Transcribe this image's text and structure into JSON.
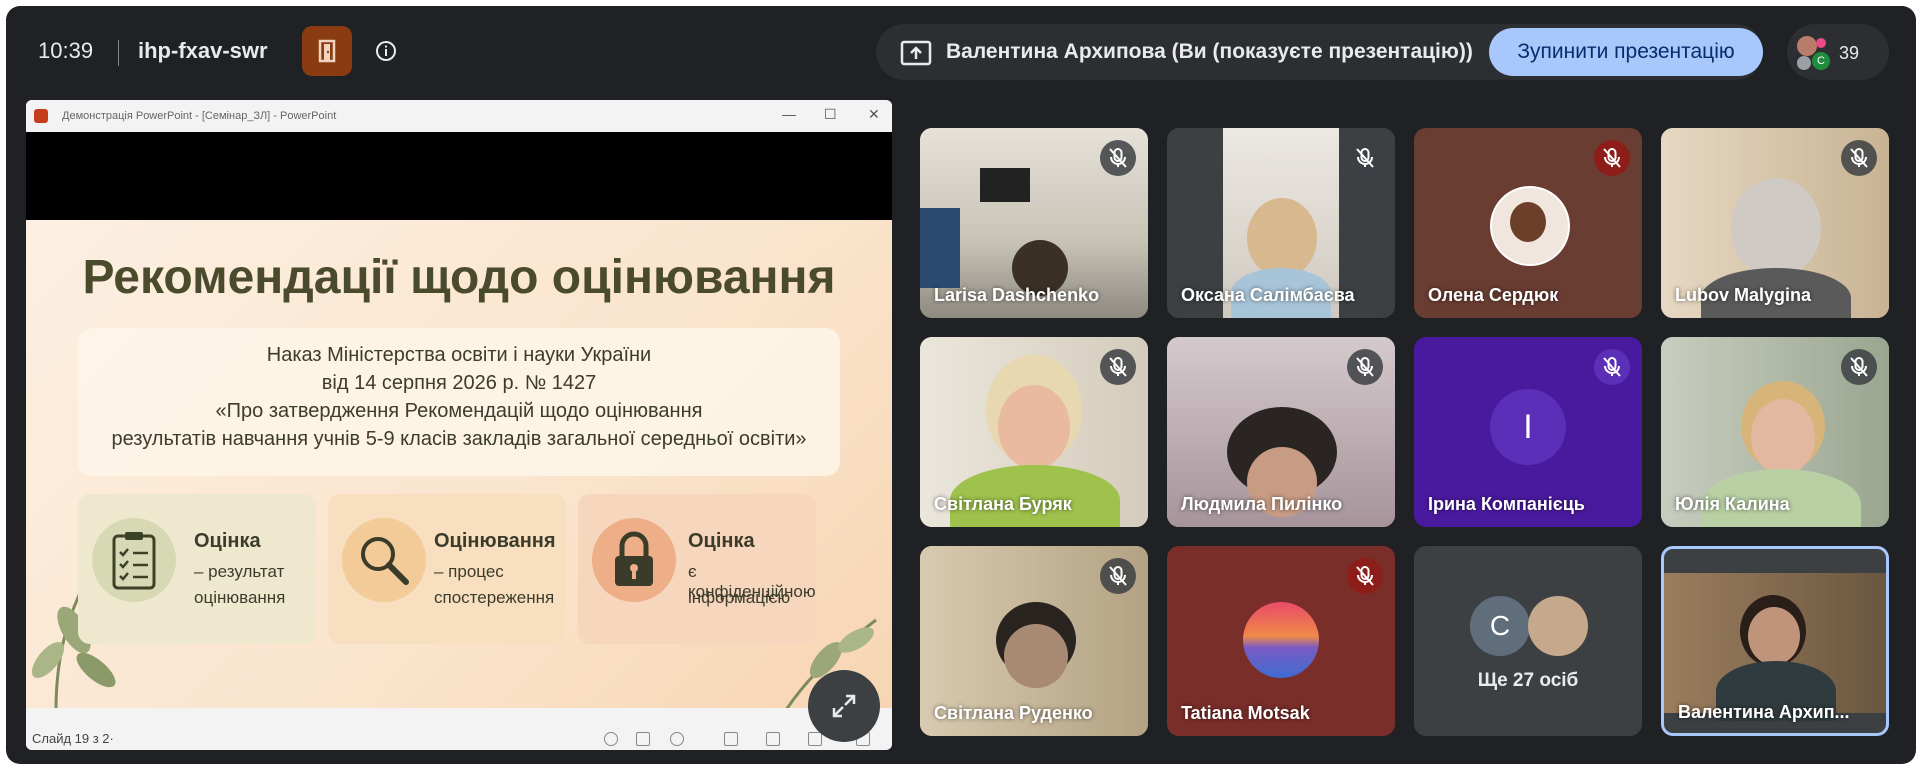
{
  "topbar": {
    "time": "10:39",
    "meeting_code": "ihp-fxav-swr",
    "presenting_text": "Валентина Архипова (Ви (показуєте презентацію))",
    "stop_button": "Зупинити презентацію",
    "participants_count": "39",
    "avatar_letter": "C"
  },
  "ppt": {
    "window_title": "Демонстрація PowerPoint - [Семінар_ЗЛ] - PowerPoint",
    "status": "Слайд 19 з 2·",
    "slide": {
      "title": "Рекомендації щодо оцінювання",
      "order_lines": [
        "Наказ Міністерства освіти і науки України",
        "від 14 серпня 2026 р. № 1427",
        "«Про затвердження Рекомендацій щодо оцінювання",
        "результатів навчання учнів 5-9 класів закладів загальної середньої освіти»"
      ],
      "cards": [
        {
          "heading": "Оцінка",
          "line1": "– результат",
          "line2": "оцінювання",
          "icon": "clipboard-icon"
        },
        {
          "heading": "Оцінювання",
          "line1": "– процес",
          "line2": "спостереження",
          "icon": "magnifier-icon"
        },
        {
          "heading": "Оцінка",
          "line1": "є конфіденційною",
          "line2": "інформацією",
          "icon": "lock-icon"
        }
      ]
    }
  },
  "participants": [
    {
      "name": "Larisa Dashchenko"
    },
    {
      "name": "Оксана Салімбаєва"
    },
    {
      "name": "Олена Сердюк"
    },
    {
      "name": "Lubov Malygina"
    },
    {
      "name": "Світлана Буряк"
    },
    {
      "name": "Людмила Пилінко"
    },
    {
      "name": "Ірина Компанієць",
      "initial": "І"
    },
    {
      "name": "Юлія Калина"
    },
    {
      "name": "Світлана Руденко"
    },
    {
      "name": "Tatiana Motsak"
    },
    {
      "name": "Ще 27 осіб",
      "initial": "C"
    },
    {
      "name": "Валентина Архип..."
    }
  ],
  "colors": {
    "background": "#202124",
    "stop_button": "#a8c7fa",
    "door_button": "#8a3b12"
  }
}
